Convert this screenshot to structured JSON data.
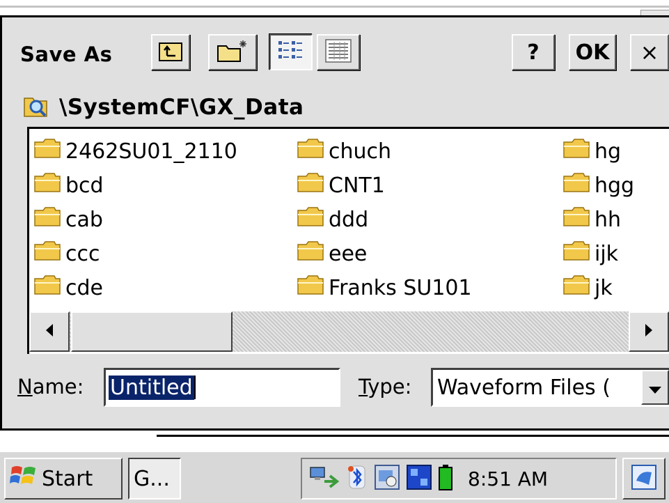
{
  "dialog": {
    "title": "Save As",
    "buttons": {
      "help": "?",
      "ok": "OK",
      "close": "×"
    },
    "path": "\\SystemCF\\GX_Data"
  },
  "files": {
    "col1": [
      "2462SU01_2110",
      "bcd",
      "cab",
      "ccc",
      "cde"
    ],
    "col2": [
      "chuch",
      "CNT1",
      "ddd",
      "eee",
      "Franks SU101"
    ],
    "col3": [
      "hg",
      "hgg",
      "hh",
      "ijk",
      "jk"
    ]
  },
  "form": {
    "name_label_accel": "N",
    "name_label_rest": "ame:",
    "name_value": "Untitled",
    "type_label_accel": "T",
    "type_label_rest": "ype:",
    "type_value": "Waveform Files ("
  },
  "taskbar": {
    "start_label": "Start",
    "task_label": "G...",
    "clock": "8:51 AM"
  },
  "colors": {
    "folder": "#f2c84b",
    "selection": "#0a246a",
    "battery": "#22bb22"
  }
}
